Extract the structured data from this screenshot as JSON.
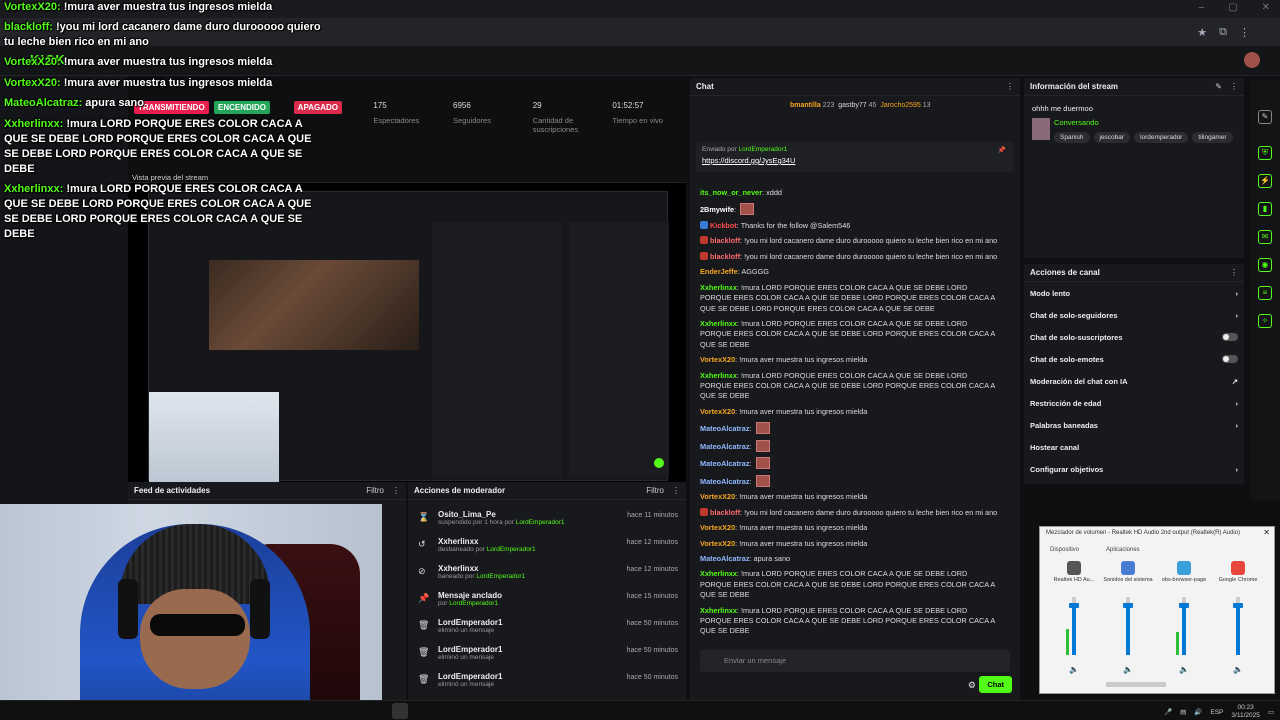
{
  "brand": "KICK",
  "stats": {
    "transmitiendo": "TRANSMITIENDO",
    "encendido": "ENCENDIDO",
    "apagado": "APAGADO",
    "espectadores": {
      "value": "175",
      "label": "Espectadores"
    },
    "seguidores": {
      "value": "6956",
      "label": "Seguidores"
    },
    "suscripciones": {
      "value": "29",
      "label": "Cantidad de suscripciones"
    },
    "tiempo": {
      "value": "01:52:57",
      "label": "Tiempo en vivo"
    }
  },
  "preview_label": "Vista previa del stream",
  "activity_feed": {
    "title": "Feed de actividades",
    "filter": "Filtro"
  },
  "mod_actions": {
    "title": "Acciones de moderador",
    "filter": "Filtro",
    "rows": [
      {
        "name": "Osito_Lima_Pe",
        "desc": "suspendido por 1 hora por",
        "by": "LordEmperador1",
        "time": "hace 11 minutos",
        "icon": "⌛"
      },
      {
        "name": "Xxherlinxx",
        "desc": "desbaneado por",
        "by": "LordEmperador1",
        "time": "hace 12 minutos",
        "icon": "↺"
      },
      {
        "name": "Xxherlinxx",
        "desc": "baneado por",
        "by": "LordEmperador1",
        "time": "hace 12 minutos",
        "icon": "⊘"
      },
      {
        "name": "Mensaje anclado",
        "desc": "por",
        "by": "LordEmperador1",
        "time": "hace 15 minutos",
        "icon": "📌"
      },
      {
        "name": "LordEmperador1",
        "desc": "eliminó un mensaje",
        "by": "",
        "time": "hace 50 minutos",
        "icon": "🗑"
      },
      {
        "name": "LordEmperador1",
        "desc": "eliminó un mensaje",
        "by": "",
        "time": "hace 50 minutos",
        "icon": "🗑"
      },
      {
        "name": "LordEmperador1",
        "desc": "eliminó un mensaje",
        "by": "",
        "time": "hace 50 minutos",
        "icon": "🗑"
      }
    ]
  },
  "chat": {
    "title": "Chat",
    "top": {
      "user1": "bmantilla",
      "count1": "223",
      "user2": "gastby77",
      "count2": "45",
      "user3": "Jarocho2595",
      "count3": "13"
    },
    "pinned": {
      "label": "Enviado por",
      "by": "LordEmperador1",
      "link": "https://discord.gg/JysEg34U"
    },
    "messages": [
      {
        "user": "its_now_or_never",
        "color": "#53fc18",
        "text": "xddd"
      },
      {
        "user": "2Bmywife",
        "color": "#ffffff",
        "text": "",
        "emote": true
      },
      {
        "user": "Kickbot",
        "color": "#ff4d4d",
        "text": "Thanks for the follow @Salem546",
        "badge": "#3b7bd8"
      },
      {
        "user": "blackloff",
        "color": "#ff6b6b",
        "text": "!you mi lord cacanero dame duro durooooo quiero tu leche bien rico en mi ano",
        "badge": "#c0392b"
      },
      {
        "user": "blackloff",
        "color": "#ff6b6b",
        "text": "!you mi lord cacanero dame duro durooooo quiero tu leche bien rico en mi ano",
        "badge": "#c0392b"
      },
      {
        "user": "EnderJeffe",
        "color": "#f5a623",
        "text": "AGGGG"
      },
      {
        "user": "Xxherlinxx",
        "color": "#53fc18",
        "text": "!mura LORD PORQUE ERES COLOR CACA A QUE SE DEBE LORD PORQUE ERES COLOR CACA A QUE SE DEBE LORD PORQUE ERES COLOR CACA A QUE SE DEBE LORD PORQUE ERES COLOR CACA A QUE SE DEBE"
      },
      {
        "user": "Xxherlinxx",
        "color": "#53fc18",
        "text": "!mura LORD PORQUE ERES COLOR CACA A QUE SE DEBE LORD PORQUE ERES COLOR CACA A QUE SE DEBE LORD PORQUE ERES COLOR CACA A QUE SE DEBE"
      },
      {
        "user": "VortexX20",
        "color": "#f5a623",
        "text": "!mura aver muestra tus ingresos mielda"
      },
      {
        "user": "Xxherlinxx",
        "color": "#53fc18",
        "text": "!mura LORD PORQUE ERES COLOR CACA A QUE SE DEBE LORD PORQUE ERES COLOR CACA A QUE SE DEBE LORD PORQUE ERES COLOR CACA A QUE SE DEBE"
      },
      {
        "user": "VortexX20",
        "color": "#f5a623",
        "text": "!mura aver muestra tus ingresos mielda"
      },
      {
        "user": "MateoAlcatraz",
        "color": "#8fb8ff",
        "text": "",
        "emote": true
      },
      {
        "user": "MateoAlcatraz",
        "color": "#8fb8ff",
        "text": "",
        "emote": true
      },
      {
        "user": "MateoAlcatraz",
        "color": "#8fb8ff",
        "text": "",
        "emote": true
      },
      {
        "user": "MateoAlcatraz",
        "color": "#8fb8ff",
        "text": "",
        "emote": true
      },
      {
        "user": "VortexX20",
        "color": "#f5a623",
        "text": "!mura aver muestra tus ingresos mielda"
      },
      {
        "user": "blackloff",
        "color": "#ff6b6b",
        "text": "!you mi lord cacanero dame duro durooooo quiero tu leche bien rico en mi ano",
        "badge": "#c0392b"
      },
      {
        "user": "VortexX20",
        "color": "#f5a623",
        "text": "!mura aver muestra tus ingresos mielda"
      },
      {
        "user": "VortexX20",
        "color": "#f5a623",
        "text": "!mura aver muestra tus ingresos mielda"
      },
      {
        "user": "MateoAlcatraz",
        "color": "#8fb8ff",
        "text": "apura sano"
      },
      {
        "user": "Xxherlinxx",
        "color": "#53fc18",
        "text": "!mura LORD PORQUE ERES COLOR CACA A QUE SE DEBE LORD PORQUE ERES COLOR CACA A QUE SE DEBE LORD PORQUE ERES COLOR CACA A QUE SE DEBE"
      },
      {
        "user": "Xxherlinxx",
        "color": "#53fc18",
        "text": "!mura LORD PORQUE ERES COLOR CACA A QUE SE DEBE LORD PORQUE ERES COLOR CACA A QUE SE DEBE LORD PORQUE ERES COLOR CACA A QUE SE DEBE"
      }
    ],
    "input_placeholder": "Enviar un mensaje",
    "send": "Chat"
  },
  "stream_info": {
    "title": "Información del stream",
    "stream_title": "ohhh me duermoo",
    "category": "Conversando",
    "tags": [
      "Spanish",
      "jescobar",
      "lordemperador",
      "tilingamer"
    ]
  },
  "channel_actions": {
    "title": "Acciones de canal",
    "items": [
      {
        "label": "Modo lento",
        "ctl": "arrow"
      },
      {
        "label": "Chat de solo-seguidores",
        "ctl": "arrow"
      },
      {
        "label": "Chat de solo-suscriptores",
        "ctl": "toggle"
      },
      {
        "label": "Chat de solo-emotes",
        "ctl": "toggle"
      },
      {
        "label": "Moderación del chat con IA",
        "ctl": "ext"
      },
      {
        "label": "Restricción de edad",
        "ctl": "arrow"
      },
      {
        "label": "Palabras baneadas",
        "ctl": "arrow"
      },
      {
        "label": "Hostear canal",
        "ctl": "none"
      },
      {
        "label": "Configurar objetivos",
        "ctl": "arrow"
      }
    ]
  },
  "overlay": [
    {
      "user": "VortexX20:",
      "text": " !mura aver muestra tus ingresos mielda"
    },
    {
      "user": "blackloff:",
      "text": " !you mi lord cacanero dame duro durooooo quiero tu leche bien rico en mi ano"
    },
    {
      "user": "VortexX20:",
      "text": " !mura aver muestra tus ingresos mielda"
    },
    {
      "user": "VortexX20:",
      "text": " !mura aver muestra tus ingresos mielda"
    },
    {
      "user": "MateoAlcatraz:",
      "text": " apura sano"
    },
    {
      "user": "Xxherlinxx:",
      "text": " !mura LORD PORQUE ERES COLOR CACA A QUE SE DEBE LORD PORQUE ERES COLOR CACA A QUE SE DEBE LORD PORQUE ERES COLOR CACA A QUE SE DEBE"
    },
    {
      "user": "Xxherlinxx:",
      "text": " !mura LORD PORQUE ERES COLOR CACA A QUE SE DEBE LORD PORQUE ERES COLOR CACA A QUE SE DEBE LORD PORQUE ERES COLOR CACA A QUE SE DEBE"
    }
  ],
  "mixer": {
    "title": "Mezclador de volumen - Realtek HD Audio 2nd output (Realtek(R) Audio)",
    "device_label": "Dispositivo",
    "apps_label": "Aplicaciones",
    "channels": [
      {
        "name": "Realtek HD Au...",
        "level": 0.85,
        "meter": 0.45,
        "color": "#555"
      },
      {
        "name": "Sonidos del sistema",
        "level": 0.85,
        "meter": 0.0,
        "color": "#4a7bd0"
      },
      {
        "name": "obs-browser-page",
        "level": 0.85,
        "meter": 0.4,
        "color": "#3aa0d8"
      },
      {
        "name": "Google Chrome",
        "level": 0.85,
        "meter": 0.0,
        "color": "#e8453c"
      }
    ]
  },
  "taskbar": {
    "lang": "ESP",
    "time": "00:23",
    "date": "3/11/2025"
  },
  "colors": {
    "accent": "#53fc18",
    "bg": "#0e0f11",
    "panel": "#18191c"
  }
}
